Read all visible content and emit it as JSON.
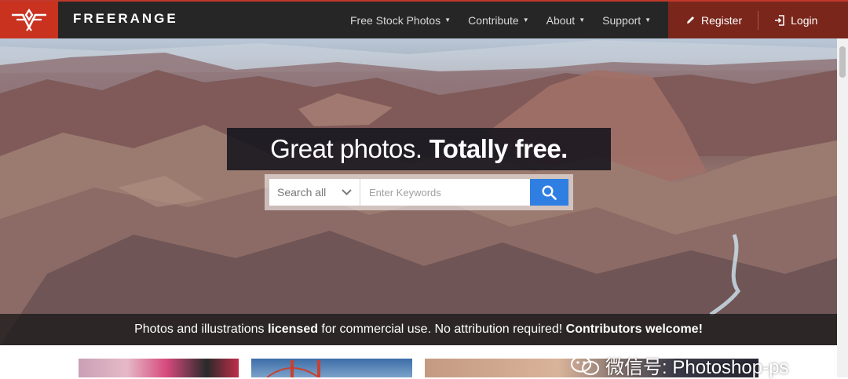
{
  "brand": {
    "name": "FREERANGE"
  },
  "nav": {
    "items": [
      {
        "label": "Free Stock Photos"
      },
      {
        "label": "Contribute"
      },
      {
        "label": "About"
      },
      {
        "label": "Support"
      }
    ],
    "caret": "▼"
  },
  "auth": {
    "register": "Register",
    "login": "Login"
  },
  "hero": {
    "headline_regular": "Great photos.",
    "headline_bold": "Totally free.",
    "search": {
      "scope_selected": "Search all",
      "keyword_placeholder": "Enter Keywords",
      "keyword_value": ""
    },
    "tagline": {
      "part1": "Photos and illustrations ",
      "bold1": "licensed",
      "part2": " for commercial use. No attribution required! ",
      "bold2": "Contributors welcome!"
    }
  },
  "watermark": {
    "text": "微信号: Photoshop-ps"
  },
  "colors": {
    "accent_red": "#c8321f",
    "auth_bg": "#7a261b",
    "topbar_bg": "#262626",
    "search_button": "#2f7fe3"
  },
  "icons": {
    "logo": "freerange-logo-icon",
    "register": "pencil-icon",
    "login": "sign-in-icon",
    "search": "search-icon",
    "scope_dropdown": "chevron-down-icon",
    "watermark": "wechat-icon"
  }
}
